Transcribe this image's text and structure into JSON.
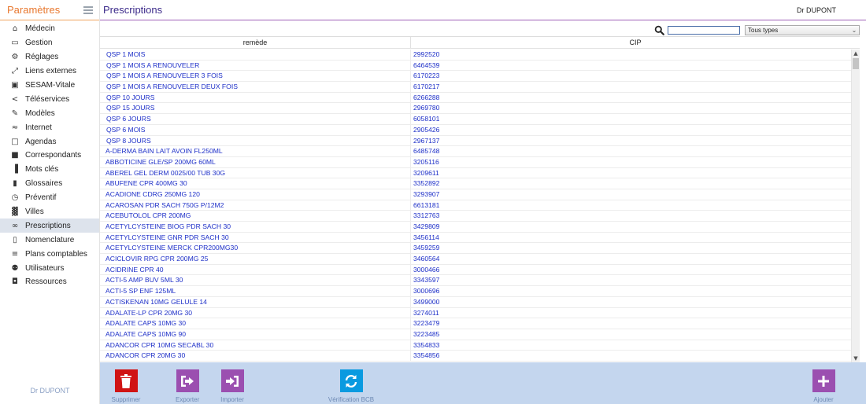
{
  "sidebar": {
    "title": "Paramètres",
    "user": "Dr DUPONT",
    "items": [
      {
        "label": "Médecin",
        "icon": "home-icon"
      },
      {
        "label": "Gestion",
        "icon": "drive-icon"
      },
      {
        "label": "Réglages",
        "icon": "gears-icon"
      },
      {
        "label": "Liens externes",
        "icon": "expand-icon"
      },
      {
        "label": "SESAM-Vitale",
        "icon": "card-icon"
      },
      {
        "label": "Téléservices",
        "icon": "share-icon"
      },
      {
        "label": "Modèles",
        "icon": "edit-icon"
      },
      {
        "label": "Internet",
        "icon": "wifi-icon"
      },
      {
        "label": "Agendas",
        "icon": "calendar-icon"
      },
      {
        "label": "Correspondants",
        "icon": "address-book-icon"
      },
      {
        "label": "Mots clés",
        "icon": "bar-chart-icon"
      },
      {
        "label": "Glossaires",
        "icon": "clipboard-icon"
      },
      {
        "label": "Préventif",
        "icon": "clock-icon"
      },
      {
        "label": "Villes",
        "icon": "buildings-icon"
      },
      {
        "label": "Prescriptions",
        "icon": "glasses-icon"
      },
      {
        "label": "Nomenclature",
        "icon": "file-icon"
      },
      {
        "label": "Plans comptables",
        "icon": "list-icon"
      },
      {
        "label": "Utilisateurs",
        "icon": "users-icon"
      },
      {
        "label": "Ressources",
        "icon": "car-icon"
      }
    ]
  },
  "header": {
    "title": "Prescriptions",
    "user": "Dr DUPONT"
  },
  "filter": {
    "search_value": "",
    "type_selected": "Tous types"
  },
  "table": {
    "columns": [
      "remède",
      "CIP"
    ],
    "rows": [
      [
        "QSP 1 MOIS",
        "2992520"
      ],
      [
        "QSP 1 MOIS A RENOUVELER",
        "6464539"
      ],
      [
        "QSP 1 MOIS A RENOUVELER 3 FOIS",
        "6170223"
      ],
      [
        "QSP 1 MOIS A RENOUVELER DEUX FOIS",
        "6170217"
      ],
      [
        "QSP 10 JOURS",
        "6266288"
      ],
      [
        "QSP 15 JOURS",
        "2969780"
      ],
      [
        "QSP 6 JOURS",
        "6058101"
      ],
      [
        "QSP 6 MOIS",
        "2905426"
      ],
      [
        "QSP 8 JOURS",
        "2967137"
      ],
      [
        "A-DERMA BAIN LAIT AVOIN FL250ML",
        "6485748"
      ],
      [
        "ABBOTICINE GLE/SP 200MG 60ML",
        "3205116"
      ],
      [
        "ABEREL GEL DERM 0025/00 TUB 30G",
        "3209611"
      ],
      [
        "ABUFENE CPR 400MG 30",
        "3352892"
      ],
      [
        "ACADIONE CDRG 250MG 120",
        "3293907"
      ],
      [
        "ACAROSAN PDR SACH 750G P/12M2",
        "6613181"
      ],
      [
        "ACEBUTOLOL CPR 200MG",
        "3312763"
      ],
      [
        "ACETYLCYSTEINE BIOG PDR SACH 30",
        "3429809"
      ],
      [
        "ACETYLCYSTEINE GNR PDR SACH 30",
        "3456114"
      ],
      [
        "ACETYLCYSTEINE MERCK CPR200MG30",
        "3459259"
      ],
      [
        "ACICLOVIR RPG CPR 200MG 25",
        "3460564"
      ],
      [
        "ACIDRINE CPR 40",
        "3000466"
      ],
      [
        "ACTI-5 AMP BUV 5ML 30",
        "3343597"
      ],
      [
        "ACTI-5 SP ENF 125ML",
        "3000696"
      ],
      [
        "ACTISKENAN 10MG GELULE 14",
        "3499000"
      ],
      [
        "ADALATE-LP CPR 20MG 30",
        "3274011"
      ],
      [
        "ADALATE CAPS 10MG 30",
        "3223479"
      ],
      [
        "ADALATE CAPS 10MG 90",
        "3223485"
      ],
      [
        "ADANCOR CPR 10MG SECABL 30",
        "3354833"
      ],
      [
        "ADANCOR CPR 20MG 30",
        "3354856"
      ]
    ]
  },
  "actions": {
    "delete": "Supprimer",
    "export": "Exporter",
    "import": "Importer",
    "verify": "Vérification BCB",
    "add": "Ajouter"
  },
  "colors": {
    "delete": "#d01414",
    "export": "#9b4fb0",
    "verify": "#0a9ae0",
    "add": "#9b4fb0",
    "actionbar": "#c4d6ee",
    "link": "#1d2fc8"
  }
}
